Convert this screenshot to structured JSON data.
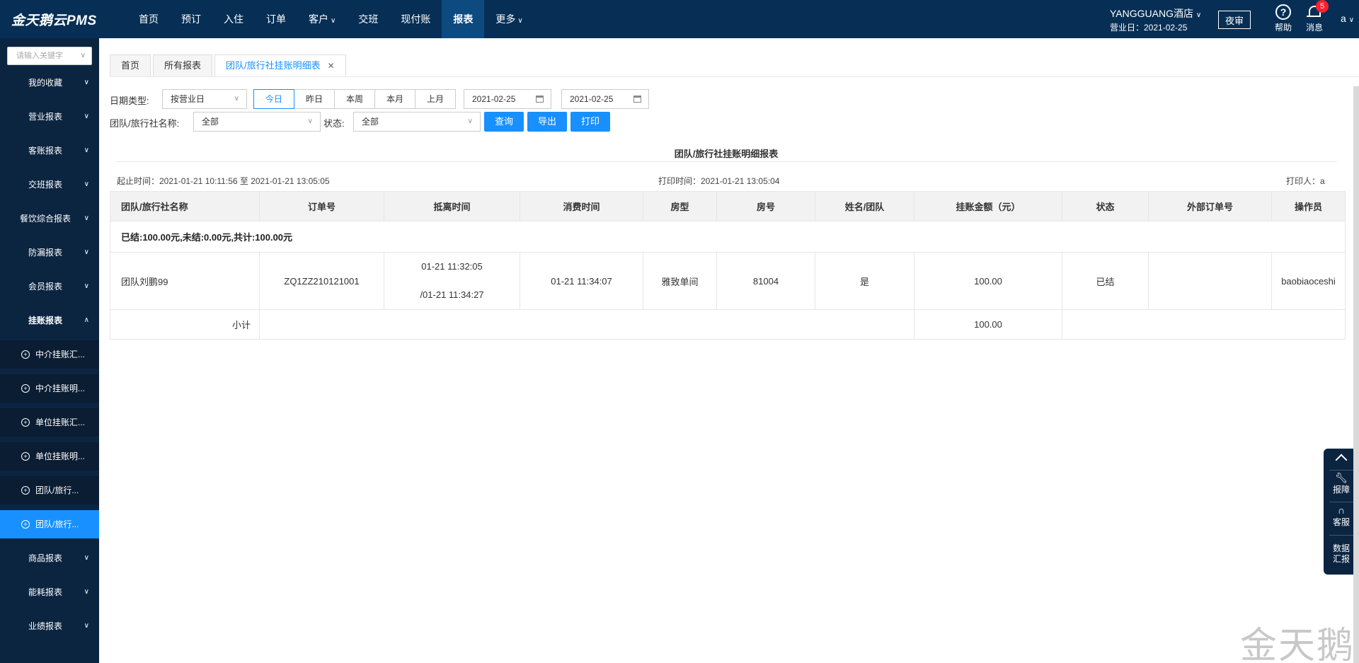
{
  "app": {
    "logo": "金天鹅云PMS"
  },
  "nav": {
    "items": [
      {
        "label": "首页",
        "has_caret": false
      },
      {
        "label": "预订",
        "has_caret": false
      },
      {
        "label": "入住",
        "has_caret": false
      },
      {
        "label": "订单",
        "has_caret": false
      },
      {
        "label": "客户",
        "has_caret": true
      },
      {
        "label": "交班",
        "has_caret": false
      },
      {
        "label": "现付账",
        "has_caret": false
      },
      {
        "label": "报表",
        "has_caret": false,
        "active": true
      },
      {
        "label": "更多",
        "has_caret": true
      }
    ]
  },
  "header": {
    "hotel": "YANGGUANG酒店",
    "business_day_label": "营业日：2021-02-25",
    "night_audit": "夜审",
    "help_label": "帮助",
    "message_label": "消息",
    "message_count": "5",
    "user": "a"
  },
  "sidebar": {
    "search_placeholder": "请输入关键字",
    "items": [
      "我的收藏",
      "营业报表",
      "客账报表",
      "交班报表",
      "餐饮综合报表",
      "防漏报表",
      "会员报表",
      "挂账报表"
    ],
    "sub_items": [
      "中介挂账汇...",
      "中介挂账明...",
      "单位挂账汇...",
      "单位挂账明...",
      "团队/旅行...",
      "团队/旅行..."
    ],
    "bottom_items": [
      "商品报表",
      "能耗报表",
      "业绩报表"
    ]
  },
  "tabs": [
    {
      "label": "首页"
    },
    {
      "label": "所有报表"
    },
    {
      "label": "团队/旅行社挂账明细表",
      "active": true
    }
  ],
  "filters": {
    "date_type_label": "日期类型:",
    "date_type_value": "按营业日",
    "periods": [
      "今日",
      "昨日",
      "本周",
      "本月",
      "上月"
    ],
    "date_from": "2021-02-25",
    "date_to": "2021-02-25",
    "group_label": "团队/旅行社名称:",
    "group_value": "全部",
    "status_label": "状态:",
    "status_value": "全部",
    "query": "查询",
    "export": "导出",
    "print": "打印"
  },
  "report": {
    "title": "团队/旅行社挂账明细报表",
    "period": "起止时间：2021-01-21 10:11:56 至 2021-01-21 13:05:05",
    "print_time": "打印时间：2021-01-21 13:05:04",
    "printer": "打印人：a",
    "columns": [
      "团队/旅行社名称",
      "订单号",
      "抵离时间",
      "消费时间",
      "房型",
      "房号",
      "姓名/团队",
      "挂账金额（元）",
      "状态",
      "外部订单号",
      "操作员"
    ],
    "summary": "已结:100.00元,未结:0.00元,共计:100.00元",
    "row": {
      "group": "团队刘鹏99",
      "order_no": "ZQ1ZZ210121001",
      "arrive": "01-21 11:32:05",
      "depart": "/01-21 11:34:27",
      "consume_time": "01-21 11:34:07",
      "room_type": "雅致单间",
      "room_no": "81004",
      "name": "是",
      "amount": "100.00",
      "status": "已结",
      "external_no": "",
      "operator": "baobiaoceshi"
    },
    "subtotal_label": "小计",
    "subtotal_amount": "100.00"
  },
  "float_tools": {
    "report_issue": "报障",
    "service": "客服",
    "data_line1": "数据",
    "data_line2": "汇报"
  },
  "watermark": "金天鹅"
}
